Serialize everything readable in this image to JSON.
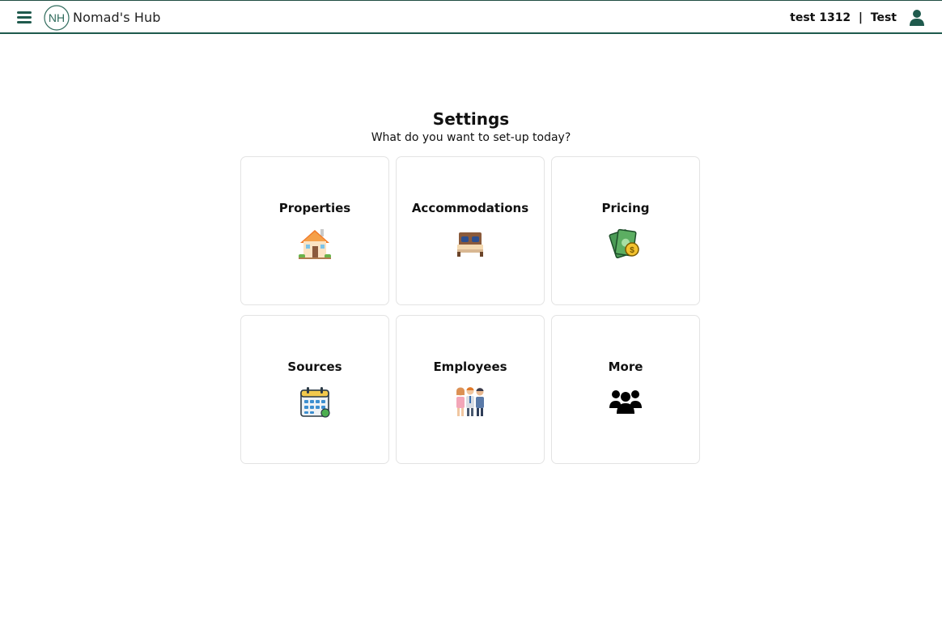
{
  "app": {
    "brand_initials": "NH",
    "brand_name": "Nomad's Hub"
  },
  "header": {
    "user_label": "test 1312  |  Test",
    "icons": {
      "menu": "hamburger-menu-icon",
      "user": "user-icon"
    }
  },
  "main": {
    "title": "Settings",
    "subtitle": "What do you want to set-up today?",
    "cards": [
      {
        "label": "Properties",
        "icon": "house-icon"
      },
      {
        "label": "Accommodations",
        "icon": "bed-icon"
      },
      {
        "label": "Pricing",
        "icon": "money-icon"
      },
      {
        "label": "Sources",
        "icon": "calendar-icon"
      },
      {
        "label": "Employees",
        "icon": "employees-icon"
      },
      {
        "label": "More",
        "icon": "users-group-icon"
      }
    ]
  },
  "colors": {
    "brand_green": "#1f5a4d",
    "card_border": "#e3e3e3"
  }
}
